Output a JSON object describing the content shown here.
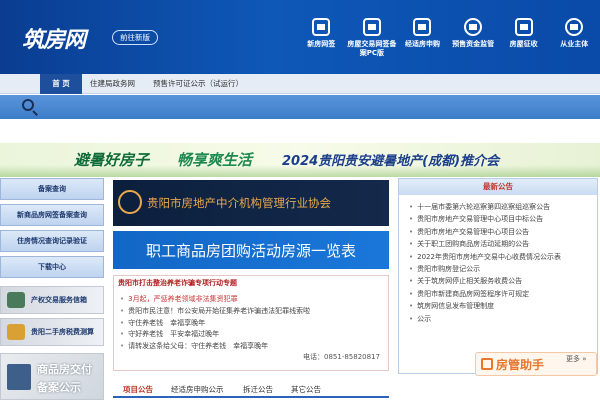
{
  "header": {
    "logo": "筑房网",
    "new_version": "前往新版",
    "nav": [
      {
        "label": "新房网签",
        "icon": "house-icon"
      },
      {
        "label": "房屋交易网签备案PC版",
        "icon": "contract-icon"
      },
      {
        "label": "经适房申购",
        "icon": "apply-icon"
      },
      {
        "label": "预售资金监管",
        "icon": "fund-icon"
      },
      {
        "label": "房屋征收",
        "icon": "expropriation-icon"
      },
      {
        "label": "从业主体",
        "icon": "people-icon"
      }
    ]
  },
  "tabs": [
    "首 页",
    "住建局政务网",
    "预售许可证公示（试运行）"
  ],
  "banner": {
    "part1": "避暑好房子",
    "part2": "畅享爽生活",
    "part3": "2024贵阳贵安避暑地产(成都)推介会"
  },
  "left": {
    "buttons": [
      "备案查询",
      "新商品房网签备案查询",
      "住房情况查询记录验证",
      "下载中心"
    ],
    "panels": [
      "产权交易服务信箱",
      "贵阳二手房税费测算"
    ],
    "promo_line1": "商品房交付",
    "promo_line2": "备案公示"
  },
  "center": {
    "association_title": "贵阳市房地产中介机构管理行业协会",
    "list_title": "职工商品房团购活动房源一览表",
    "notice_title": "贵阳市打击整治养老诈骗专项行动专题",
    "notice_items": [
      "3月起，严惩养老领域非法集资犯罪",
      "贵阳市民注意！市公安局开始征集养老诈骗违法犯罪线索啦",
      "守住养老钱　幸福享晚年",
      "守好养老钱　平安幸福过晚年",
      "请转发这条给父母：守住养老钱　幸福享晚年"
    ],
    "phone": "电话：0851-85820817",
    "bottom_tabs": [
      "项目公告",
      "经适房申购公示",
      "拆迁公告",
      "其它公告"
    ]
  },
  "right": {
    "title": "最新公告",
    "items": [
      "十一届市委第六轮巡察第四巡察组巡察公告",
      "贵阳市房地产交易管理中心项目中标公告",
      "贵阳市房地产交易管理中心项目公告",
      "关于职工团购商品房活动延期的公告",
      "2022年贵阳市房地产交易中心收费情况公示表",
      "贵阳市购房登记公示",
      "关于筑房网停止相关服务收费公告",
      "贵阳市新建商品房网签程序许可规定",
      "筑房网信息发布管理制度",
      "公示"
    ],
    "more": "更多 »",
    "helper": "房管助手"
  },
  "colors": {
    "header": "#0e58b8",
    "accent": "#c0392b",
    "tab_active": "#1e4f9c"
  }
}
